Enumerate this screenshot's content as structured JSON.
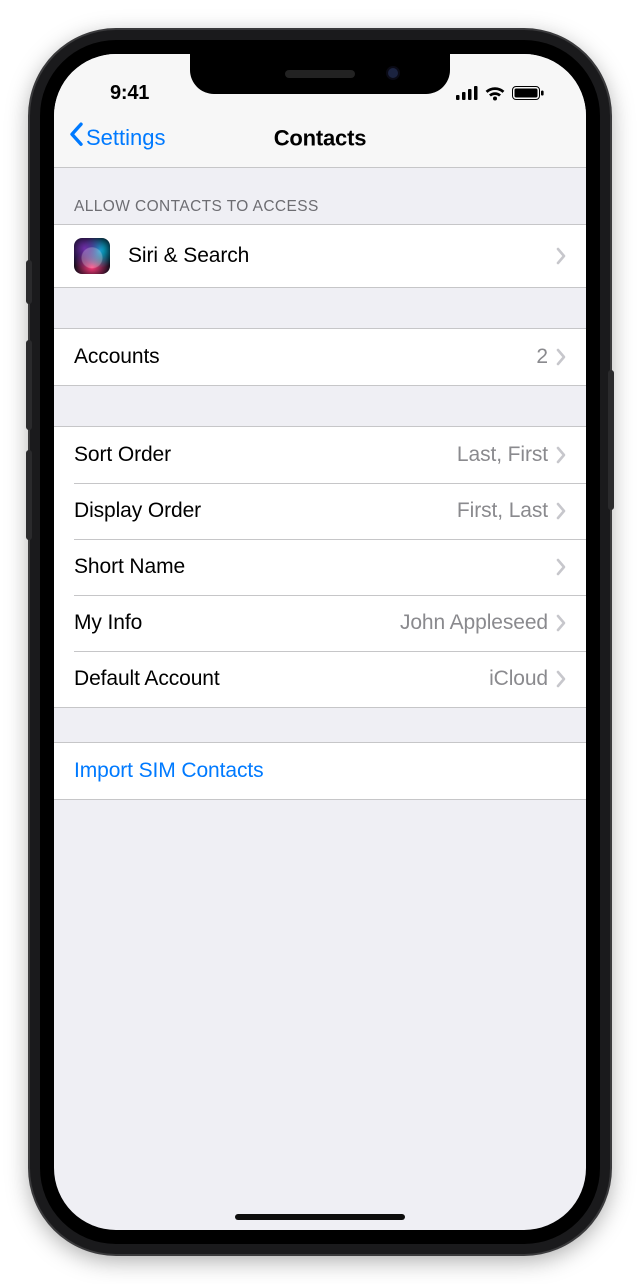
{
  "status": {
    "time": "9:41"
  },
  "nav": {
    "back_label": "Settings",
    "title": "Contacts"
  },
  "sections": {
    "access": {
      "header": "ALLOW CONTACTS TO ACCESS",
      "siri_label": "Siri & Search"
    },
    "accounts": {
      "label": "Accounts",
      "value": "2"
    },
    "prefs": {
      "sort_order": {
        "label": "Sort Order",
        "value": "Last, First"
      },
      "display_order": {
        "label": "Display Order",
        "value": "First, Last"
      },
      "short_name": {
        "label": "Short Name",
        "value": ""
      },
      "my_info": {
        "label": "My Info",
        "value": "John Appleseed"
      },
      "default_account": {
        "label": "Default Account",
        "value": "iCloud"
      }
    },
    "import_sim": {
      "label": "Import SIM Contacts"
    }
  },
  "colors": {
    "tint": "#007aff",
    "bg": "#efeff4",
    "separator": "#c6c6c8",
    "secondary_text": "#8a8a8e"
  }
}
